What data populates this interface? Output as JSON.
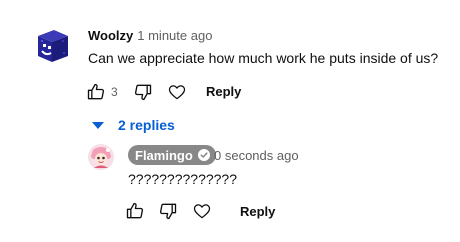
{
  "comment": {
    "author": "Woolzy",
    "time": "1 minute ago",
    "text": "Can we appreciate how much work he puts inside of us?",
    "likes": "3",
    "reply_label": "Reply",
    "avatar_icon": "blue-cube-avatar-icon"
  },
  "replies_toggle": {
    "label": "2 replies",
    "icon": "caret-down-icon",
    "color": "#065fd4"
  },
  "reply": {
    "author": "Flamingo",
    "time": "0 seconds ago",
    "text": "??????????????",
    "reply_label": "Reply",
    "badge_color": "#888888",
    "avatar_icon": "flamingo-avatar-icon"
  }
}
